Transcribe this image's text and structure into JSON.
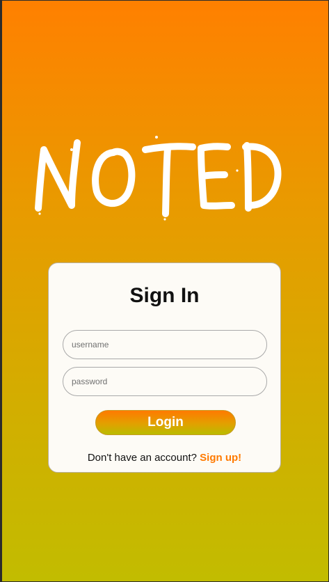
{
  "app": {
    "logo_text": "NOTED"
  },
  "login_card": {
    "title": "Sign In",
    "username_placeholder": "username",
    "password_placeholder": "password",
    "login_label": "Login",
    "signup_prompt": "Don't have an account?",
    "signup_link": "Sign up!"
  },
  "colors": {
    "gradient_top": "#ff8000",
    "gradient_bottom": "#c2bc00",
    "accent": "#ff7a00",
    "card_bg": "#fdfbf6"
  }
}
